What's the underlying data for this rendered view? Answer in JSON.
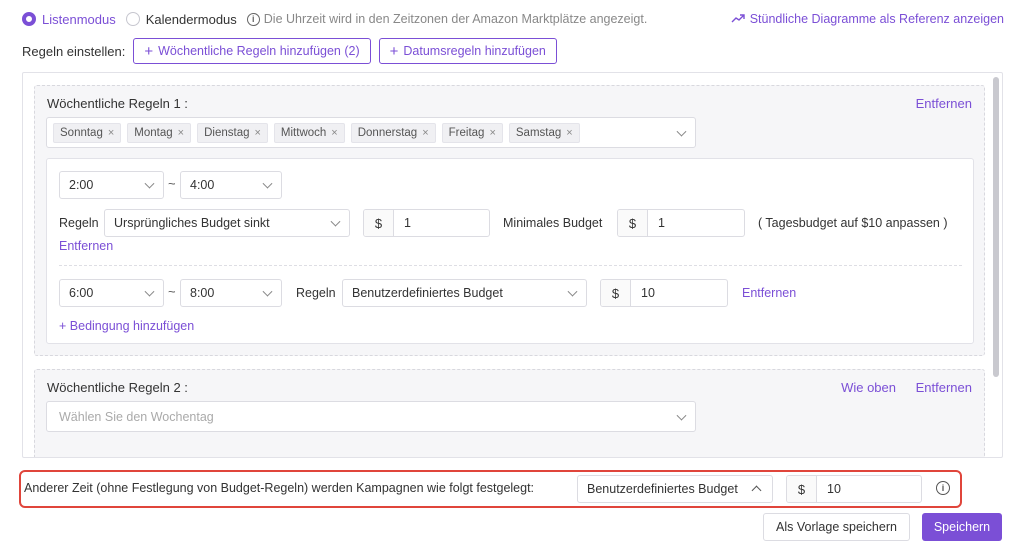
{
  "mode": {
    "list_label": "Listenmodus",
    "calendar_label": "Kalendermodus",
    "note": "Die Uhrzeit wird in den Zeitzonen der Amazon Marktplätze angezeigt.",
    "chart_link": "Stündliche Diagramme als Referenz anzeigen"
  },
  "rules_bar": {
    "label": "Regeln einstellen:",
    "add_weekly": "Wöchentliche Regeln hinzufügen (2)",
    "add_date": "Datumsregeln hinzufügen"
  },
  "weekly1": {
    "title": "Wöchentliche Regeln 1 :",
    "remove": "Entfernen",
    "days": [
      "Sonntag",
      "Montag",
      "Dienstag",
      "Mittwoch",
      "Donnerstag",
      "Freitag",
      "Samstag"
    ],
    "slot1": {
      "from": "2:00",
      "to": "4:00",
      "rules_label": "Regeln",
      "rule": "Ursprüngliches Budget sinkt",
      "currency": "$",
      "value": "1",
      "min_label": "Minimales Budget",
      "min_currency": "$",
      "min_value": "1",
      "hint": "( Tagesbudget auf $10 anpassen )",
      "remove": "Entfernen"
    },
    "slot2": {
      "from": "6:00",
      "to": "8:00",
      "rules_label": "Regeln",
      "rule": "Benutzerdefiniertes Budget",
      "currency": "$",
      "value": "10",
      "remove": "Entfernen"
    },
    "add_condition": "Bedingung hinzufügen"
  },
  "weekly2": {
    "title": "Wöchentliche Regeln 2 :",
    "same_as_above": "Wie oben",
    "remove": "Entfernen",
    "day_placeholder": "Wählen Sie den Wochentag"
  },
  "other_time": {
    "text": "Anderer Zeit (ohne Festlegung von Budget-Regeln) werden Kampagnen wie folgt festgelegt:",
    "rule": "Benutzerdefiniertes Budget",
    "currency": "$",
    "value": "10"
  },
  "actions": {
    "save_template": "Als Vorlage speichern",
    "save": "Speichern"
  },
  "colors": {
    "accent": "#7b4fd6",
    "highlight": "#e0453b"
  }
}
